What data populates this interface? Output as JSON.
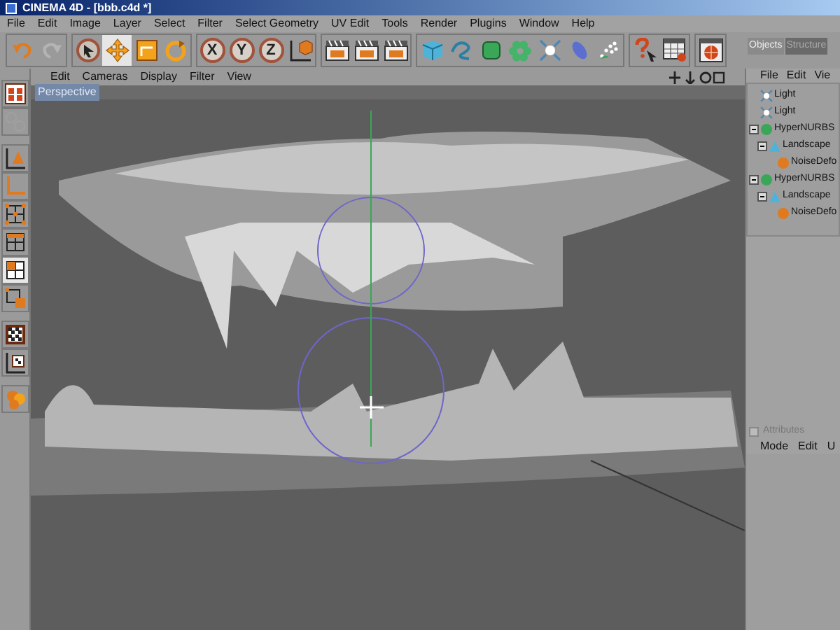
{
  "window": {
    "title": "CINEMA 4D - [bbb.c4d *]"
  },
  "menu": [
    "File",
    "Edit",
    "Image",
    "Layer",
    "Select",
    "Filter",
    "Select Geometry",
    "UV Edit",
    "Tools",
    "Render",
    "Plugins",
    "Window",
    "Help"
  ],
  "toolbar": [
    [
      {
        "kind": "undo",
        "active": false
      },
      {
        "kind": "redo",
        "active": false
      }
    ],
    [
      {
        "kind": "select",
        "active": false
      },
      {
        "kind": "move",
        "active": true
      },
      {
        "kind": "scale",
        "active": false
      },
      {
        "kind": "rotate",
        "active": false
      }
    ],
    [
      {
        "kind": "axis",
        "label": "X",
        "active": false
      },
      {
        "kind": "axis",
        "label": "Y",
        "active": false
      },
      {
        "kind": "axis",
        "label": "Z",
        "active": false
      },
      {
        "kind": "coords",
        "active": false
      }
    ],
    [
      {
        "kind": "clapper",
        "active": false
      },
      {
        "kind": "clapper",
        "active": false
      },
      {
        "kind": "clapper",
        "active": false
      }
    ],
    [
      {
        "kind": "cube",
        "active": false
      },
      {
        "kind": "spline",
        "active": false
      },
      {
        "kind": "nurbs",
        "active": false
      },
      {
        "kind": "flower",
        "active": false
      },
      {
        "kind": "light",
        "active": false
      },
      {
        "kind": "deform",
        "active": false
      },
      {
        "kind": "particles",
        "active": false
      }
    ],
    [
      {
        "kind": "help",
        "active": false
      },
      {
        "kind": "table",
        "active": false
      }
    ],
    [
      {
        "kind": "globe",
        "active": false
      }
    ]
  ],
  "left_toolbar": [
    [
      {
        "kind": "viewlayout",
        "active": false
      },
      {
        "kind": "disabled",
        "active": false
      }
    ],
    [
      {
        "kind": "object",
        "active": false
      },
      {
        "kind": "model",
        "active": false
      },
      {
        "kind": "points",
        "active": false
      },
      {
        "kind": "edges",
        "active": false
      },
      {
        "kind": "polygons",
        "active": true
      },
      {
        "kind": "uvpoints",
        "active": false
      }
    ],
    [
      {
        "kind": "texture",
        "active": false
      },
      {
        "kind": "texaxis",
        "active": false
      }
    ],
    [
      {
        "kind": "spheres",
        "active": false
      }
    ]
  ],
  "viewport": {
    "menu": [
      "Edit",
      "Cameras",
      "Display",
      "Filter",
      "View"
    ],
    "label": "Perspective"
  },
  "objects_panel": {
    "tabs": [
      {
        "label": "Objects",
        "selected": true
      },
      {
        "label": "Structure",
        "selected": false
      }
    ],
    "menu": [
      "File",
      "Edit",
      "Vie"
    ],
    "tree": [
      {
        "name": "Light",
        "kind": "light"
      },
      {
        "name": "Light",
        "kind": "light"
      },
      {
        "name": "HyperNURBS",
        "kind": "nurbs",
        "expanded": true,
        "children": [
          {
            "name": "Landscape",
            "kind": "landscape",
            "expanded": true,
            "children": [
              {
                "name": "NoiseDefo",
                "kind": "deformer"
              }
            ]
          }
        ]
      },
      {
        "name": "HyperNURBS",
        "kind": "nurbs",
        "expanded": true,
        "children": [
          {
            "name": "Landscape",
            "kind": "landscape",
            "expanded": true,
            "children": [
              {
                "name": "NoiseDefo",
                "kind": "deformer"
              }
            ]
          }
        ]
      }
    ]
  },
  "attributes_panel": {
    "title": "Attributes",
    "menu": [
      "Mode",
      "Edit",
      "U"
    ]
  }
}
